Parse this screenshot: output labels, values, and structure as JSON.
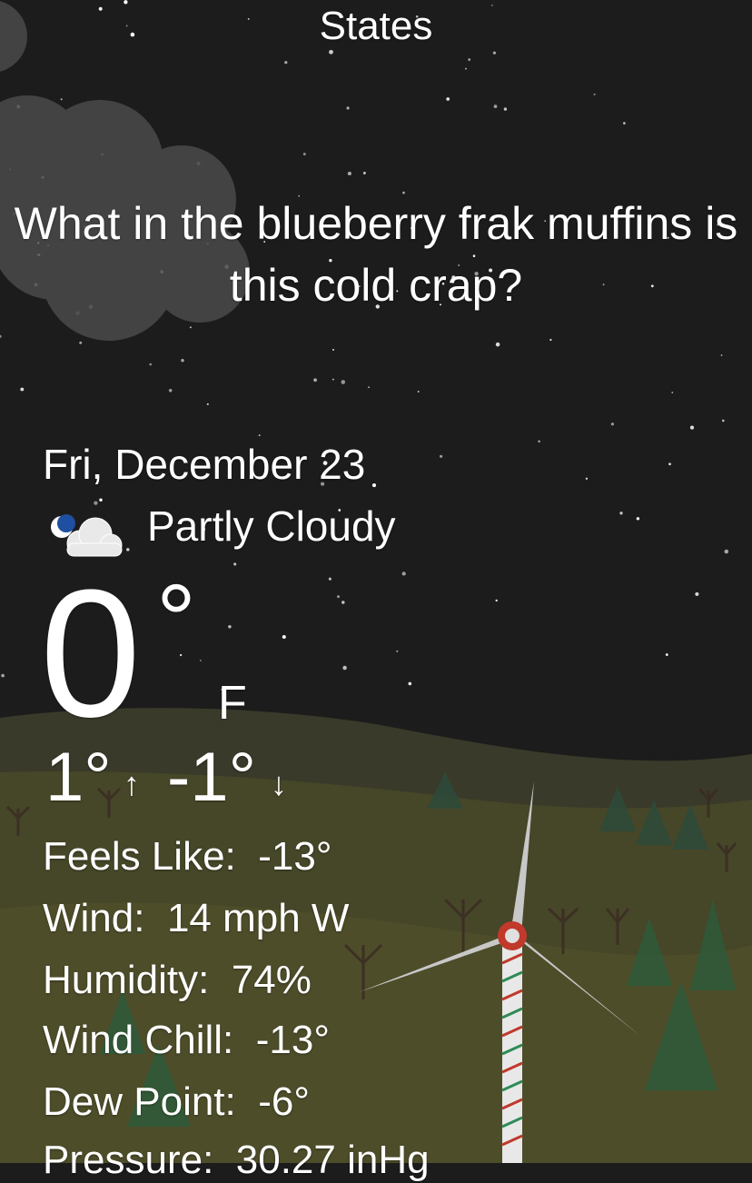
{
  "header": {
    "location": "States",
    "headline": "What in the blueberry frak muffins is this cold crap?"
  },
  "forecast": {
    "date": "Fri, December 23",
    "condition": "Partly Cloudy",
    "condition_icon": "partly-cloudy-night-icon",
    "temperature": "0",
    "degree_symbol": "°",
    "unit": "F",
    "high": "1°",
    "high_arrow": "↑",
    "low": "-1°",
    "low_arrow": "↓"
  },
  "details": [
    {
      "label": "Feels Like:",
      "value": "-13°"
    },
    {
      "label": "Wind:",
      "value": "14 mph W"
    },
    {
      "label": "Humidity:",
      "value": "74%"
    },
    {
      "label": "Wind Chill:",
      "value": "-13°"
    },
    {
      "label": "Dew Point:",
      "value": "-6°"
    },
    {
      "label": "Pressure:",
      "value": "30.27 inHg"
    }
  ],
  "colors": {
    "sky": "#1c1c1c",
    "hill_back": "#3f3f2c",
    "hill_front": "#4a4a2a",
    "text": "#ffffff"
  }
}
